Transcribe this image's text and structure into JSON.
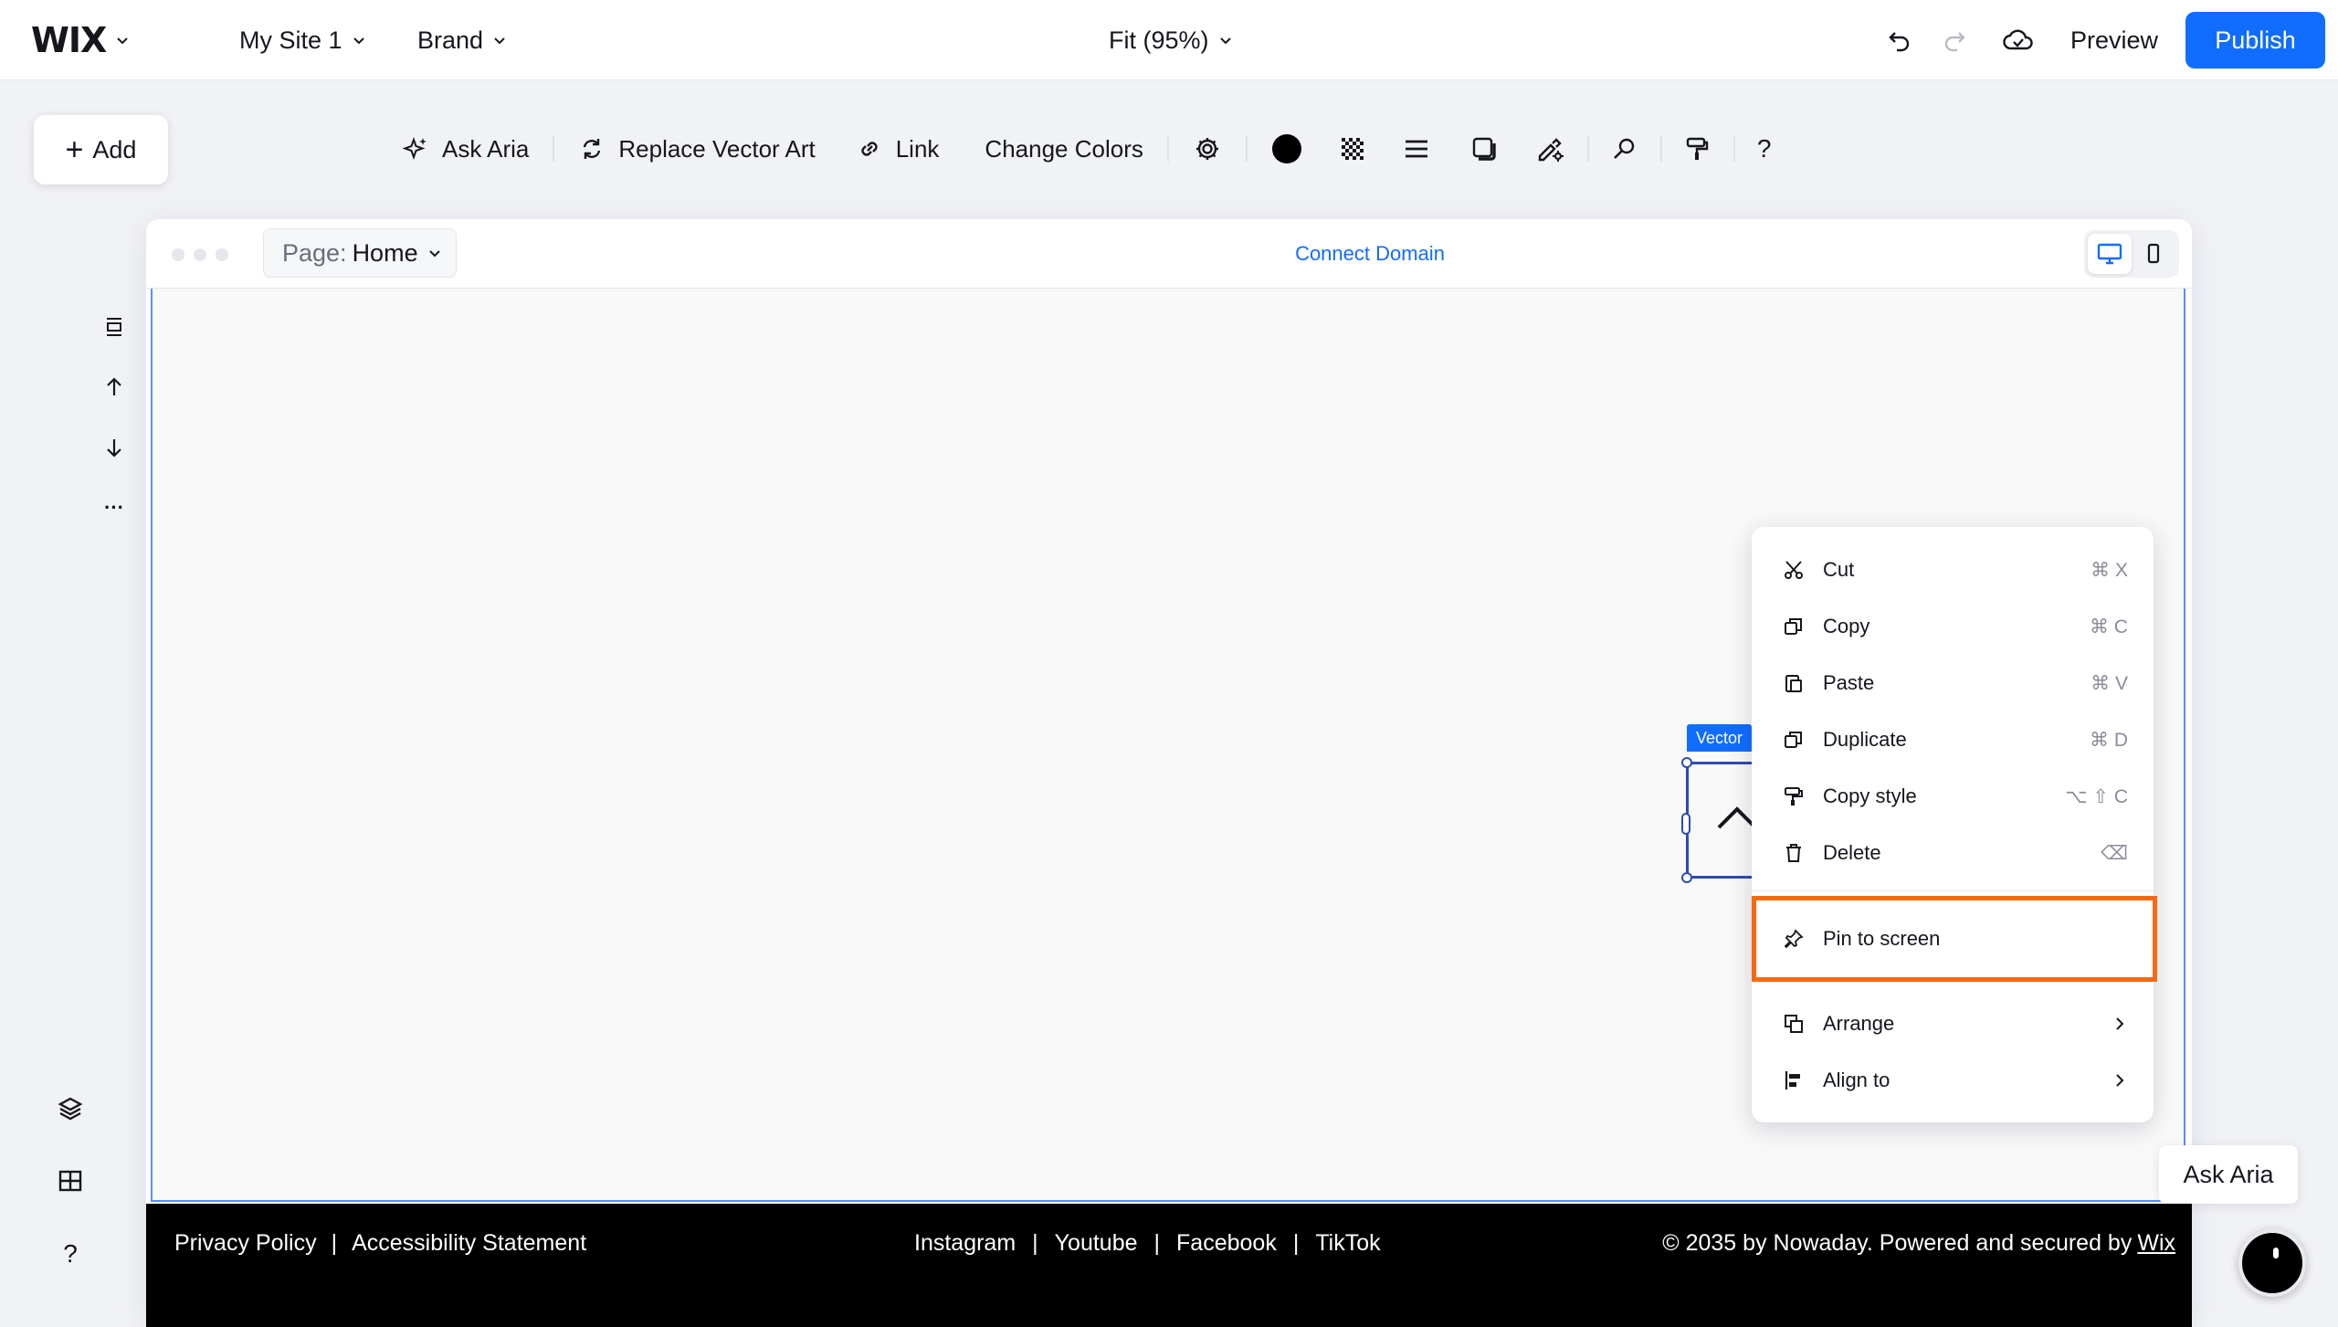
{
  "topbar": {
    "logo": "WIX",
    "site_name": "My Site 1",
    "brand": "Brand",
    "zoom": "Fit (95%)",
    "preview": "Preview",
    "publish": "Publish"
  },
  "add_button": {
    "label": "Add"
  },
  "toolbar": {
    "ask_aria": "Ask Aria",
    "replace_vector_art": "Replace Vector Art",
    "link": "Link",
    "change_colors": "Change Colors",
    "help": "?"
  },
  "side_tools": {
    "more": "···",
    "help": "?"
  },
  "frame": {
    "page_label": "Page:",
    "page_value": "Home",
    "connect_domain": "Connect Domain"
  },
  "footer": {
    "privacy": "Privacy Policy",
    "accessibility": "Accessibility Statement",
    "social": [
      "Instagram",
      "Youtube",
      "Facebook",
      "TikTok"
    ],
    "separator": "|",
    "copyright": "© 2035 by Nowaday. Powered and secured by",
    "wix_link": "Wix"
  },
  "selection": {
    "tag": "Vector"
  },
  "context_menu": {
    "items": [
      {
        "label": "Cut",
        "shortcut": "⌘ X",
        "icon": "scissors-icon"
      },
      {
        "label": "Copy",
        "shortcut": "⌘ C",
        "icon": "copy-icon"
      },
      {
        "label": "Paste",
        "shortcut": "⌘ V",
        "icon": "paste-icon"
      },
      {
        "label": "Duplicate",
        "shortcut": "⌘ D",
        "icon": "duplicate-icon"
      },
      {
        "label": "Copy style",
        "shortcut": "⌥ ⇧ C",
        "icon": "paint-roller-icon"
      },
      {
        "label": "Delete",
        "shortcut": "⌫",
        "icon": "trash-icon"
      },
      {
        "label": "Pin to screen",
        "shortcut": "",
        "icon": "pin-icon"
      },
      {
        "label": "Arrange",
        "shortcut": "",
        "icon": "arrange-icon"
      },
      {
        "label": "Align to",
        "shortcut": "",
        "icon": "align-left-icon"
      }
    ],
    "highlight_color": "#f56a12"
  },
  "aria_bubble": {
    "label": "Ask Aria"
  },
  "colors": {
    "accent": "#116dff",
    "selection": "#2e4bb5",
    "footer_bg": "#000000"
  }
}
